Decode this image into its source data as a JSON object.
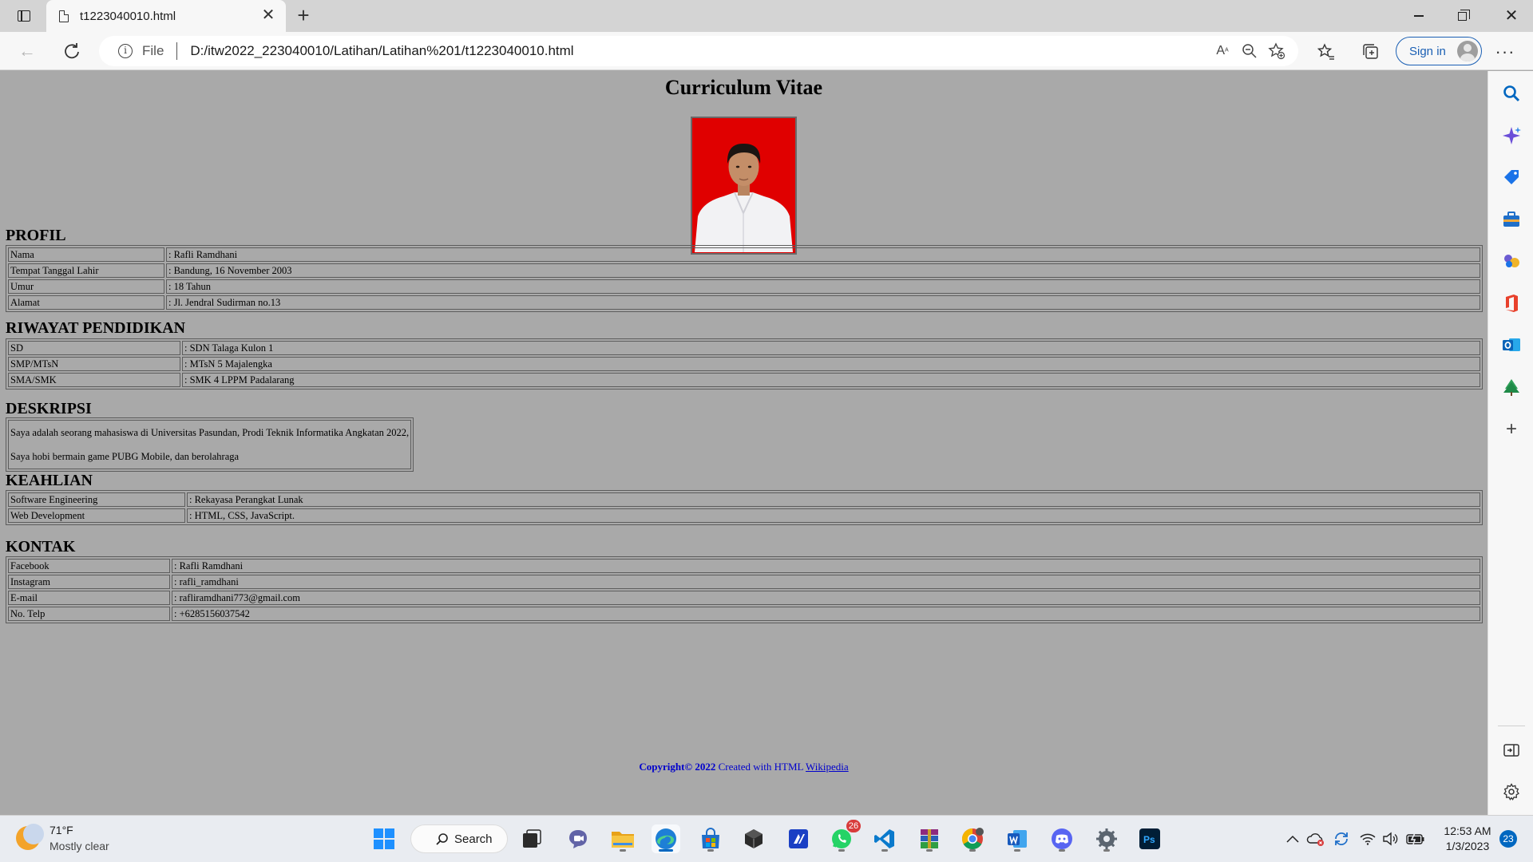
{
  "browser": {
    "tab_title": "t1223040010.html",
    "url_scheme": "File",
    "url": "D:/itw2022_223040010/Latihan/Latihan%201/t1223040010.html",
    "signin_label": "Sign in"
  },
  "page": {
    "title": "Curriculum Vitae",
    "sections": {
      "profil": {
        "heading": "PROFIL",
        "rows": [
          {
            "label": "Nama",
            "value": ": Rafli Ramdhani"
          },
          {
            "label": "Tempat Tanggal Lahir",
            "value": ": Bandung, 16 November 2003"
          },
          {
            "label": "Umur",
            "value": ": 18 Tahun"
          },
          {
            "label": "Alamat",
            "value": ": Jl. Jendral Sudirman no.13"
          }
        ]
      },
      "pendidikan": {
        "heading": "RIWAYAT PENDIDIKAN",
        "rows": [
          {
            "label": "SD",
            "value": ": SDN Talaga Kulon 1"
          },
          {
            "label": "SMP/MTsN",
            "value": ": MTsN 5 Majalengka"
          },
          {
            "label": "SMA/SMK",
            "value": ": SMK 4 LPPM Padalarang"
          }
        ]
      },
      "deskripsi": {
        "heading": "DESKRIPSI",
        "lines": [
          "Saya adalah seorang mahasiswa di Universitas Pasundan, Prodi Teknik Informatika Angkatan 2022,",
          "Saya hobi bermain game PUBG Mobile, dan berolahraga"
        ]
      },
      "keahlian": {
        "heading": "KEAHLIAN",
        "rows": [
          {
            "label": "Software Engineering",
            "value": ": Rekayasa Perangkat Lunak"
          },
          {
            "label": "Web Development",
            "value": ": HTML, CSS, JavaScript."
          }
        ]
      },
      "kontak": {
        "heading": "KONTAK",
        "rows": [
          {
            "label": "Facebook",
            "value": ": Rafli Ramdhani"
          },
          {
            "label": "Instagram",
            "value": ": rafli_ramdhani"
          },
          {
            "label": "E-mail",
            "value": ": rafliramdhani773@gmail.com"
          },
          {
            "label": "No. Telp",
            "value": ": +6285156037542"
          }
        ]
      }
    },
    "footer": {
      "copyright": "Copyright© 2022",
      "created_with": "Created with HTML",
      "link": "Wikipedia"
    }
  },
  "taskbar": {
    "weather_temp": "71°F",
    "weather_condition": "Mostly clear",
    "search_label": "Search",
    "whatsapp_badge": "26",
    "clock_time": "12:53 AM",
    "clock_date": "1/3/2023",
    "notification_count": "23",
    "accent_color": "#0067c0"
  },
  "colors": {
    "page_background": "#a9a9a9",
    "photo_background": "#e00000",
    "footer_text": "#0000cc",
    "signin_accent": "#1a5fb4"
  }
}
